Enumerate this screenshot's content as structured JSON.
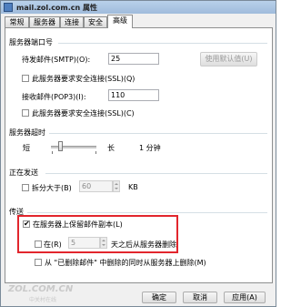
{
  "window": {
    "title": "mail.zol.com.cn 属性"
  },
  "tabs": [
    "常规",
    "服务器",
    "连接",
    "安全",
    "高级"
  ],
  "server_ports": {
    "heading": "服务器端口号",
    "smtp_label": "待发邮件(SMTP)(O):",
    "smtp_value": "25",
    "use_defaults_label": "使用默认值(U)",
    "smtp_ssl_label": "此服务器要求安全连接(SSL)(Q)",
    "pop3_label": "接收邮件(POP3)(I):",
    "pop3_value": "110",
    "pop3_ssl_label": "此服务器要求安全连接(SSL)(C)"
  },
  "timeout": {
    "heading": "服务器超时",
    "short_label": "短",
    "long_label": "长",
    "value_label": "1 分钟",
    "slider_fraction": 0.17
  },
  "sending": {
    "heading": "正在发送",
    "split_label": "拆分大于(B)",
    "split_value": "60",
    "unit": "KB",
    "split_checked": false
  },
  "delivery": {
    "heading": "传送",
    "leave_copy_label": "在服务器上保留邮件副本(L)",
    "leave_copy_checked": true,
    "remove_after_label": "在(R)",
    "remove_after_value": "5",
    "remove_after_suffix": "天之后从服务器删除",
    "remove_after_checked": false,
    "remove_when_deleted_label": "从 \"已删除邮件\" 中删除的同时从服务器上删除(M)",
    "remove_when_deleted_checked": false,
    "check_mark": "✔"
  },
  "footer": {
    "ok": "确定",
    "cancel": "取消",
    "apply": "应用(A)"
  },
  "watermark": {
    "text": "ZOL.COM.CN",
    "sub": "中关村在线"
  }
}
